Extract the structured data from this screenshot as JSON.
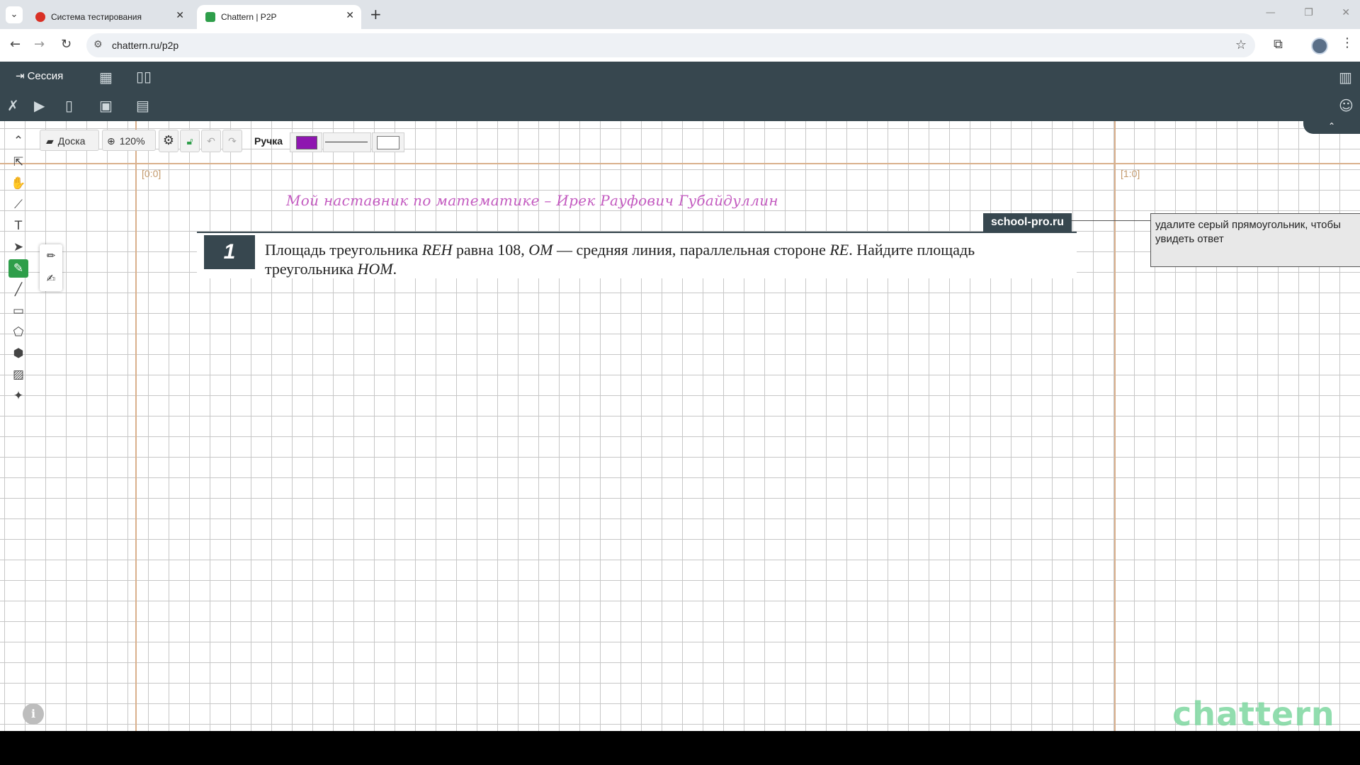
{
  "browser": {
    "tabs": [
      {
        "title": "Система тестирования",
        "active": false,
        "favicon_color": "#d93025"
      },
      {
        "title": "Chattern | P2P",
        "active": true,
        "favicon_color": "#2e9e4a"
      }
    ],
    "url": "chattern.ru/p2p"
  },
  "header": {
    "session_label": "Сессия"
  },
  "board_toolbar": {
    "board_label": "Доска",
    "zoom": "120%",
    "pen_label": "Ручка",
    "pen_color": "#8e16b0"
  },
  "board": {
    "coord_left": "[0:0]",
    "coord_right": "[1:0]",
    "mentor_line": "Мой наставник по математике – Ирек Рауфович Губайдуллин",
    "source_tag": "school-pro.ru",
    "task_number": "1",
    "task_text_parts": [
      "Площадь треугольника ",
      "REH",
      " равна 108, ",
      "OM",
      " — средняя линия, параллельная стороне ",
      "RE",
      ". Найдите площадь треугольника ",
      "HOM",
      "."
    ],
    "answer_hint": "удалите серый прямоугольник, чтобы увидеть ответ",
    "watermark": "chattern",
    "info_label": "i"
  }
}
